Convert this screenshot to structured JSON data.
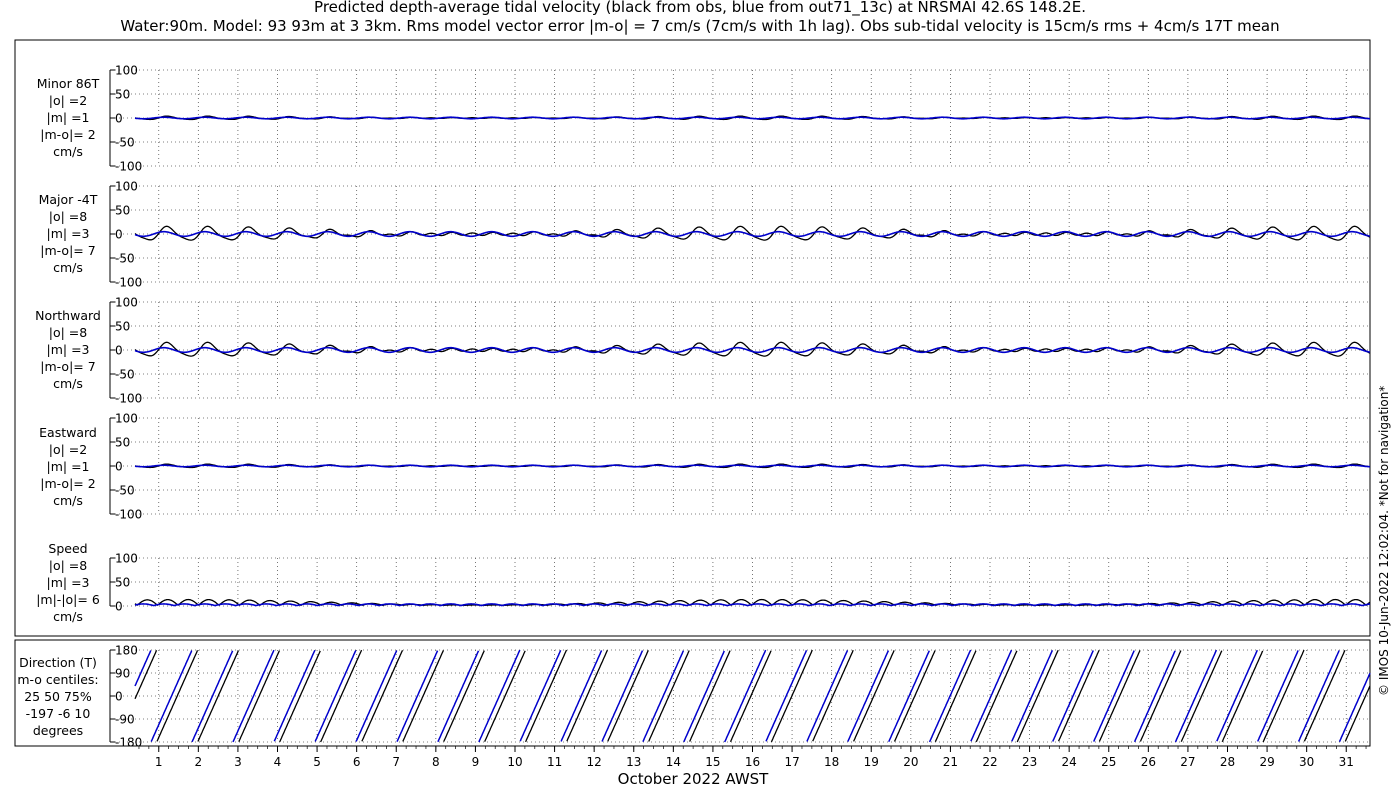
{
  "title_line1": "Predicted depth-average tidal velocity (black from obs, blue from out71_13c) at NRSMAI 42.6S 148.2E.",
  "title_line2": "Water:90m. Model: 93 93m at 3 3km. Rms model vector error |m-o| = 7 cm/s (7cm/s with 1h lag). Obs sub-tidal velocity is 15cm/s rms + 4cm/s 17T mean",
  "credit": "© IMOS 10-Jun-2022 12:02:04. *Not for navigation*",
  "colors": {
    "obs": "#000000",
    "model": "#0000cc",
    "grid": "#555555"
  },
  "chart_data": {
    "type": "line",
    "xlabel": "October 2022 AWST",
    "x_ticks": [
      "1",
      "2",
      "3",
      "4",
      "5",
      "6",
      "7",
      "8",
      "9",
      "10",
      "11",
      "12",
      "13",
      "14",
      "15",
      "16",
      "17",
      "18",
      "19",
      "20",
      "21",
      "22",
      "23",
      "24",
      "25",
      "26",
      "27",
      "28",
      "29",
      "30",
      "31"
    ],
    "xlim_days": [
      0.4,
      31.6
    ],
    "series_colors": {
      "obs": "black",
      "model": "blue"
    },
    "panels": [
      {
        "id": "minor",
        "label_lines": [
          "Minor 86T",
          "|o| =2",
          "|m| =1",
          "|m-o|= 2",
          "cm/s"
        ],
        "ylim": [
          -100,
          100
        ],
        "yticks": [
          "100",
          "50",
          "0",
          "-50",
          "-100"
        ],
        "obs_amp": 2,
        "model_amp": 1
      },
      {
        "id": "major",
        "label_lines": [
          "Major -4T",
          "|o| =8",
          "|m| =3",
          "|m-o|= 7",
          "cm/s"
        ],
        "ylim": [
          -100,
          100
        ],
        "yticks": [
          "100",
          "50",
          "0",
          "-50",
          "-100"
        ],
        "obs_amp": 8,
        "model_amp": 3
      },
      {
        "id": "north",
        "label_lines": [
          "Northward",
          "|o| =8",
          "|m| =3",
          "|m-o|= 7",
          "cm/s"
        ],
        "ylim": [
          -100,
          100
        ],
        "yticks": [
          "100",
          "50",
          "0",
          "-50",
          "-100"
        ],
        "obs_amp": 8,
        "model_amp": 3
      },
      {
        "id": "east",
        "label_lines": [
          "Eastward",
          "|o| =2",
          "|m| =1",
          "|m-o|= 2",
          "cm/s"
        ],
        "ylim": [
          -100,
          100
        ],
        "yticks": [
          "100",
          "50",
          "0",
          "-50",
          "-100"
        ],
        "obs_amp": 2,
        "model_amp": 1
      },
      {
        "id": "speed",
        "label_lines": [
          "Speed",
          "|o| =8",
          "|m| =3",
          "|m|-|o|= 6",
          "cm/s"
        ],
        "ylim": [
          0,
          100
        ],
        "yticks": [
          "100",
          "50",
          "0"
        ],
        "obs_amp": 8,
        "model_amp": 3
      },
      {
        "id": "direction",
        "label_lines": [
          "Direction (T)",
          "m-o centiles:",
          "25  50  75%",
          "-197  -6   10",
          "degrees"
        ],
        "ylim": [
          -180,
          180
        ],
        "yticks": [
          "180",
          "90",
          "0",
          "-90",
          "-180"
        ]
      }
    ]
  }
}
